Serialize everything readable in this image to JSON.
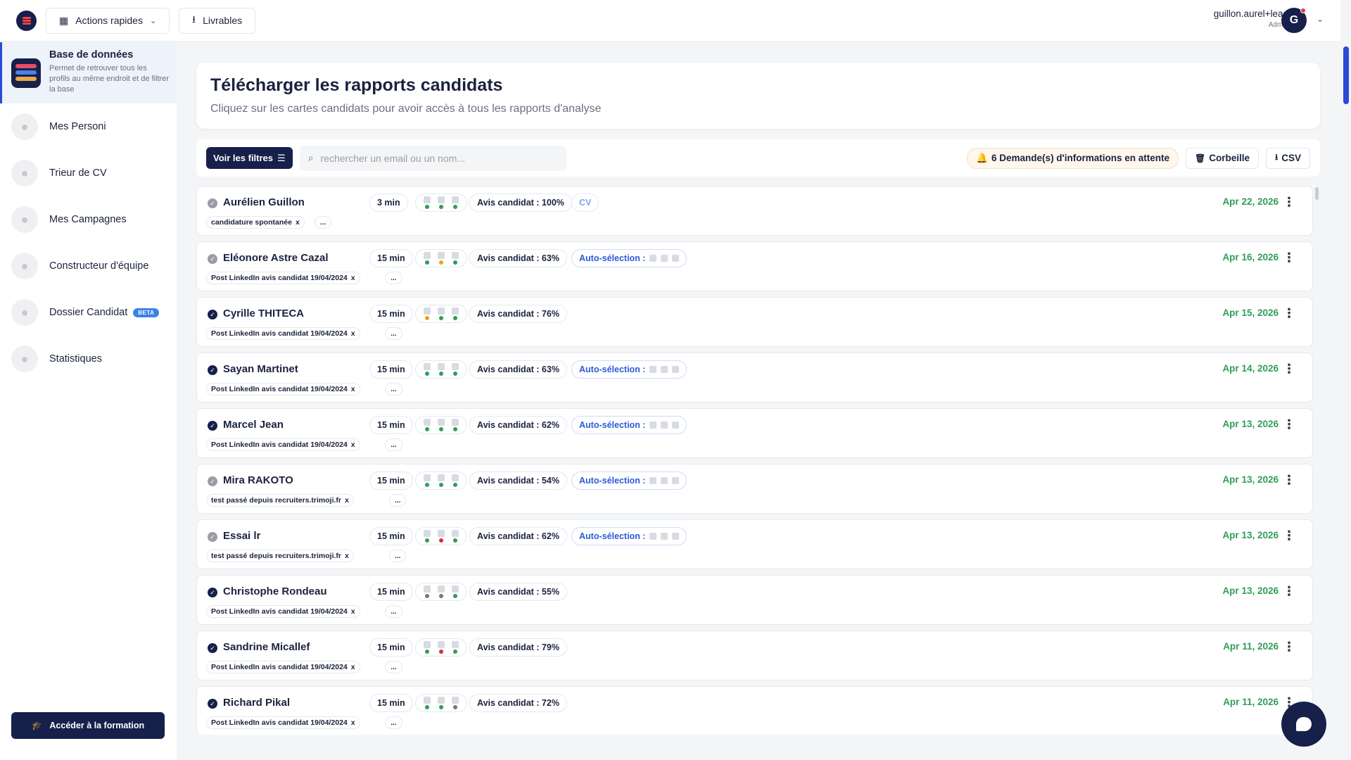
{
  "topbar": {
    "quick_actions_label": "Actions rapides",
    "deliverables_label": "Livrables",
    "user_name": "guillon.aurel+lead",
    "user_role": "Admin",
    "avatar_letter": "G"
  },
  "sidebar": {
    "active": {
      "title": "Base de données",
      "description": "Permet de retrouver tous les profils au même endroit et de filtrer la base"
    },
    "items": [
      {
        "label": "Mes Personi",
        "icon": "person-icon"
      },
      {
        "label": "Trieur de CV",
        "icon": "cv-icon"
      },
      {
        "label": "Mes Campagnes",
        "icon": "campaign-icon"
      },
      {
        "label": "Constructeur d'équipe",
        "icon": "team-icon"
      },
      {
        "label": "Dossier Candidat",
        "icon": "folder-person-icon",
        "badge": "BETA"
      },
      {
        "label": "Statistiques",
        "icon": "stats-icon"
      }
    ],
    "training_button": "Accéder à la formation"
  },
  "header": {
    "title": "Télécharger les rapports candidats",
    "subtitle": "Cliquez sur les cartes candidats pour avoir accès à tous les rapports d'analyse"
  },
  "toolbar": {
    "filters_label": "Voir les filtres",
    "search_placeholder": "rechercher un email ou un nom...",
    "pending_label": "6 Demande(s) d'informations en attente",
    "trash_label": "Corbeille",
    "csv_label": "CSV"
  },
  "candidates": [
    {
      "name": "Aurélien Guillon",
      "done": false,
      "duration": "3 min",
      "avis": "Avis candidat : 100%",
      "extra": "CV",
      "tag": "candidature spontanée",
      "more": "...",
      "date": "Apr 22, 2026",
      "dots": [
        "#2f9e57",
        "#2f9e57",
        "#2f9e57"
      ]
    },
    {
      "name": "Eléonore Astre Cazal",
      "done": false,
      "duration": "15 min",
      "avis": "Avis candidat : 63%",
      "extra": "Auto-sélection :",
      "tag": "Post LinkedIn avis candidat 19/04/2024",
      "more": "...",
      "date": "Apr 16, 2026",
      "dots": [
        "#2f9e57",
        "#f0a020",
        "#2f9e57"
      ]
    },
    {
      "name": "Cyrille THITECA",
      "done": true,
      "duration": "15 min",
      "avis": "Avis candidat : 76%",
      "extra": "",
      "tag": "Post LinkedIn avis candidat 19/04/2024",
      "more": "...",
      "date": "Apr 15, 2026",
      "dots": [
        "#f0a020",
        "#2f9e57",
        "#2f9e57"
      ]
    },
    {
      "name": "Sayan Martinet",
      "done": true,
      "duration": "15 min",
      "avis": "Avis candidat : 63%",
      "extra": "Auto-sélection :",
      "tag": "Post LinkedIn avis candidat 19/04/2024",
      "more": "...",
      "date": "Apr 14, 2026",
      "dots": [
        "#2f9e57",
        "#2f9e57",
        "#2f9e57"
      ]
    },
    {
      "name": "Marcel Jean",
      "done": true,
      "duration": "15 min",
      "avis": "Avis candidat : 62%",
      "extra": "Auto-sélection :",
      "tag": "Post LinkedIn avis candidat 19/04/2024",
      "more": "...",
      "date": "Apr 13, 2026",
      "dots": [
        "#2f9e57",
        "#2f9e57",
        "#2f9e57"
      ]
    },
    {
      "name": "Mira RAKOTO",
      "done": false,
      "duration": "15 min",
      "avis": "Avis candidat : 54%",
      "extra": "Auto-sélection :",
      "tag": "test passé depuis recruiters.trimoji.fr",
      "more": "...",
      "date": "Apr 13, 2026",
      "dots": [
        "#2f9e57",
        "#2f9e57",
        "#2f9e57"
      ]
    },
    {
      "name": "Essai lr",
      "done": false,
      "duration": "15 min",
      "avis": "Avis candidat : 62%",
      "extra": "Auto-sélection :",
      "tag": "test passé depuis recruiters.trimoji.fr",
      "more": "...",
      "date": "Apr 13, 2026",
      "dots": [
        "#2f9e57",
        "#d93030",
        "#2f9e57"
      ]
    },
    {
      "name": "Christophe Rondeau",
      "done": true,
      "duration": "15 min",
      "avis": "Avis candidat : 55%",
      "extra": "",
      "tag": "Post LinkedIn avis candidat 19/04/2024",
      "more": "...",
      "date": "Apr 13, 2026",
      "dots": [
        "#777",
        "#777",
        "#2f9e57"
      ]
    },
    {
      "name": "Sandrine Micallef",
      "done": true,
      "duration": "15 min",
      "avis": "Avis candidat : 79%",
      "extra": "",
      "tag": "Post LinkedIn avis candidat 19/04/2024",
      "more": "...",
      "date": "Apr 11, 2026",
      "dots": [
        "#2f9e57",
        "#d93030",
        "#2f9e57"
      ]
    },
    {
      "name": "Richard Pikal",
      "done": true,
      "duration": "15 min",
      "avis": "Avis candidat : 72%",
      "extra": "",
      "tag": "Post LinkedIn avis candidat 19/04/2024",
      "more": "...",
      "date": "Apr 11, 2026",
      "dots": [
        "#2f9e57",
        "#2f9e57",
        "#777"
      ]
    }
  ]
}
